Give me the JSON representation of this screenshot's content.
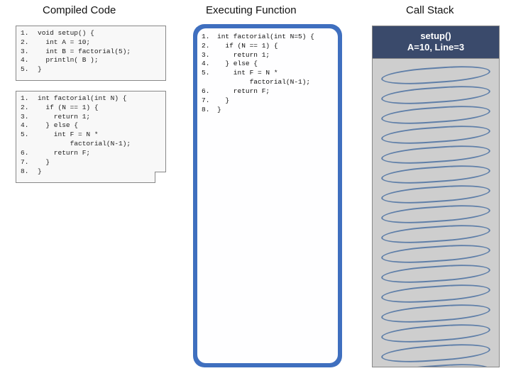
{
  "titles": {
    "compiled": "Compiled Code",
    "executing": "Executing Function",
    "stack": "Call Stack"
  },
  "compiled": {
    "setup": [
      {
        "n": "1.",
        "t": "void setup() {"
      },
      {
        "n": "2.",
        "t": "  int A = 10;"
      },
      {
        "n": "3.",
        "t": "  int B = factorial(5);"
      },
      {
        "n": "4.",
        "t": "  println( B );"
      },
      {
        "n": "5.",
        "t": "}"
      }
    ],
    "factorial": [
      {
        "n": "1.",
        "t": "int factorial(int N) {"
      },
      {
        "n": "2.",
        "t": "  if (N == 1) {"
      },
      {
        "n": "3.",
        "t": "    return 1;"
      },
      {
        "n": "4.",
        "t": "  } else {"
      },
      {
        "n": "5.",
        "t": "    int F = N *"
      },
      {
        "n": "",
        "t": "        factorial(N-1);"
      },
      {
        "n": "6.",
        "t": "    return F;"
      },
      {
        "n": "7.",
        "t": "  }"
      },
      {
        "n": "8.",
        "t": "}"
      }
    ]
  },
  "executing": [
    {
      "n": "1.",
      "t": "int factorial(int N=5) {"
    },
    {
      "n": "2.",
      "t": "  if (N == 1) {"
    },
    {
      "n": "3.",
      "t": "    return 1;"
    },
    {
      "n": "4.",
      "t": "  } else {"
    },
    {
      "n": "5.",
      "t": "    int F = N *"
    },
    {
      "n": "",
      "t": "        factorial(N-1);"
    },
    {
      "n": "6.",
      "t": "    return F;"
    },
    {
      "n": "7.",
      "t": "  }"
    },
    {
      "n": "8.",
      "t": "}"
    }
  ],
  "stack": {
    "frames": [
      {
        "title": "setup()",
        "detail": "A=10, Line=3"
      }
    ],
    "spring_count": 16
  }
}
